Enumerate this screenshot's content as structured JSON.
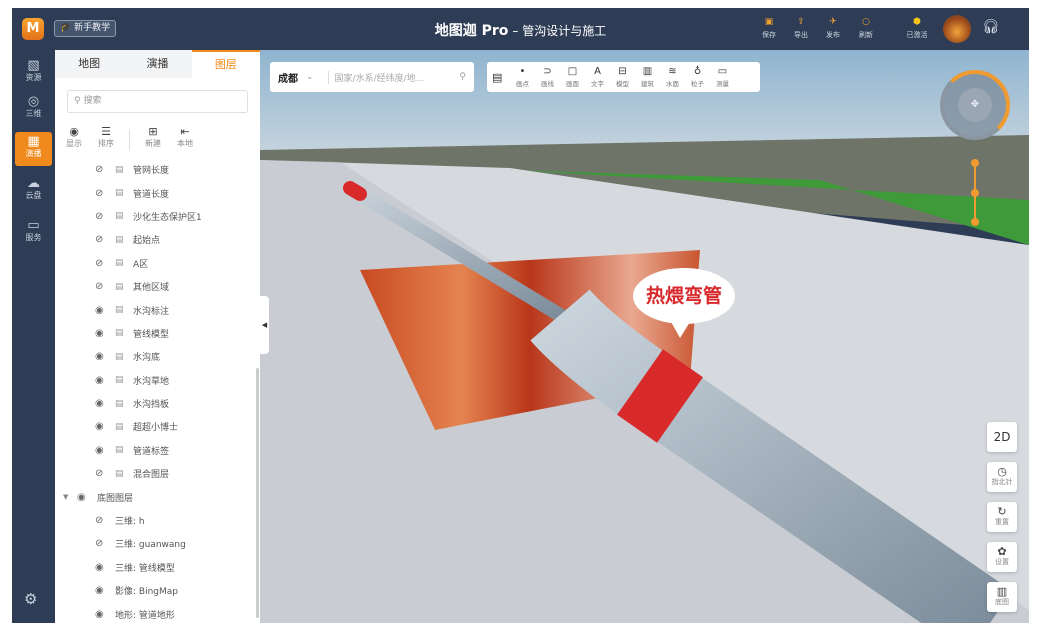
{
  "header": {
    "tutorial": "新手教学",
    "title": "地图迦 Pro",
    "subtitle": "– 管沟设计与施工",
    "actions": [
      {
        "icon": "save-icon",
        "label": "保存"
      },
      {
        "icon": "export-icon",
        "label": "导出"
      },
      {
        "icon": "publish-icon",
        "label": "发布"
      },
      {
        "icon": "refresh-icon",
        "label": "刷新"
      }
    ],
    "status": "已激活"
  },
  "nav": [
    {
      "label": "资源"
    },
    {
      "label": "三维"
    },
    {
      "label": "演播"
    },
    {
      "label": "云盘"
    },
    {
      "label": "服务"
    }
  ],
  "panel": {
    "tabs": [
      "地图",
      "演播",
      "图层"
    ],
    "active_tab": "图层",
    "search_placeholder": "搜索",
    "tools": [
      "显示",
      "排序",
      "新建",
      "本地"
    ],
    "layers": [
      "管网长度",
      "管道长度",
      "沙化生态保护区1",
      "起始点",
      "A区",
      "其他区域",
      "水沟标注",
      "管线模型",
      "水沟底",
      "水沟草地",
      "水沟挡板",
      "超超小博士",
      "管道标签",
      "混合图层"
    ],
    "base_group": "底图图层",
    "base_layers": [
      "三维: h",
      "三维: guanwang",
      "三维: 管线模型",
      "影像: BingMap",
      "地形: 管道地形"
    ]
  },
  "map": {
    "city": "成都",
    "search_placeholder": "国家/水系/经纬度/地...",
    "draw_tools": [
      "画点",
      "画线",
      "画面",
      "文字",
      "模型",
      "建筑",
      "水面",
      "粒子",
      "测量"
    ],
    "callout": "热煨弯管",
    "right_tools": [
      "2D",
      "指北针",
      "重置",
      "设置",
      "底图"
    ]
  },
  "colors": {
    "accent": "#f08a1c",
    "header": "#2e3d55",
    "callout": "#d8282c"
  }
}
